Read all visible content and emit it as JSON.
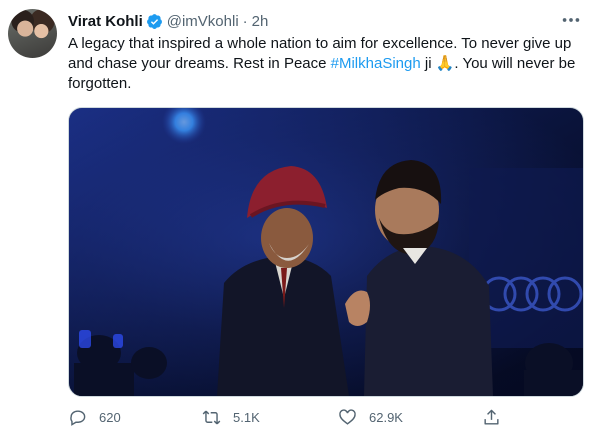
{
  "tweet": {
    "author_name": "Virat Kohli",
    "handle": "@imVkohli",
    "separator": "·",
    "time": "2h",
    "text_part1": "A legacy that inspired a whole nation to aim for excellence. To never give up and chase your dreams. Rest in Peace ",
    "hashtag": "#MilkhaSingh",
    "text_part2": " ji ",
    "emoji": "🙏",
    "text_part3": ". You will never be forgotten.",
    "reply_count": "620",
    "retweet_count": "5.1K",
    "like_count": "62.9K"
  },
  "icons": {
    "verified": "verified-badge-icon",
    "more": "more-horizontal-icon",
    "reply": "reply-icon",
    "retweet": "retweet-icon",
    "like": "heart-icon",
    "share": "share-icon"
  },
  "colors": {
    "accent": "#1d9bf0",
    "secondary_text": "#536471",
    "primary_text": "#0f1419"
  }
}
